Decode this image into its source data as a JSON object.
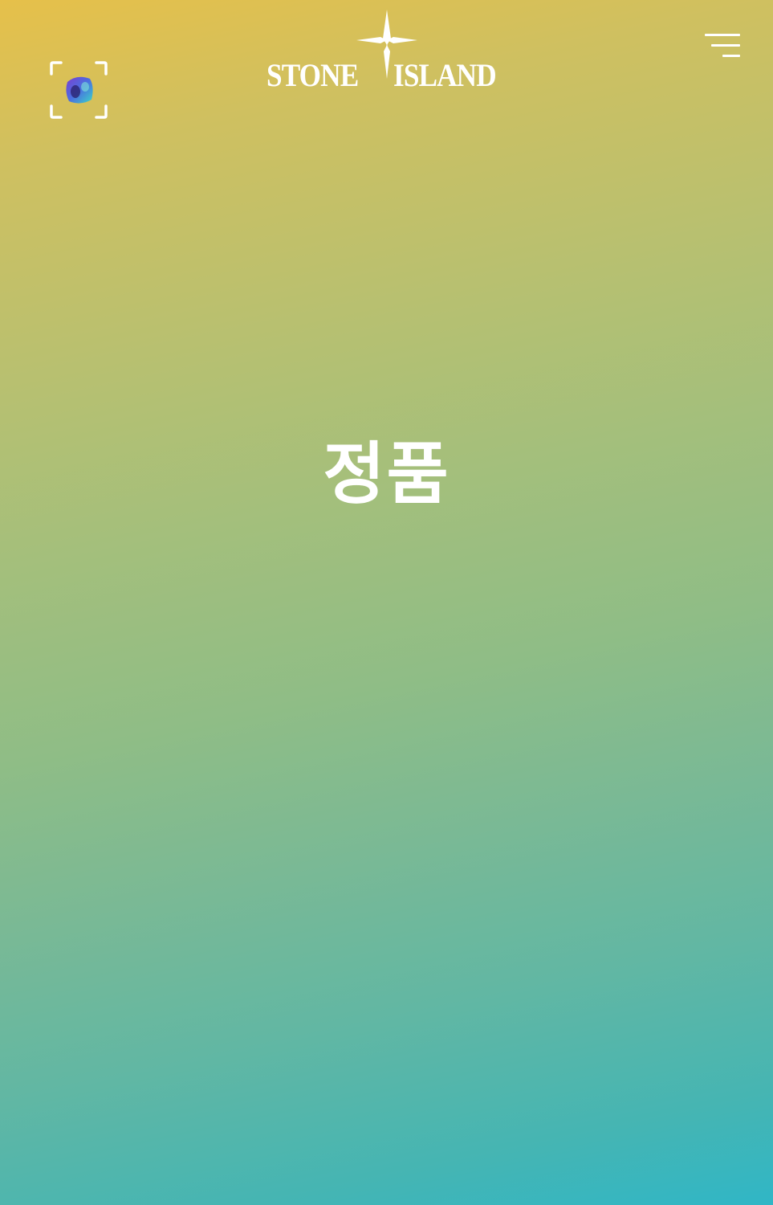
{
  "header": {
    "brand_left": "STONE",
    "brand_right": "ISLAND",
    "scan_icon": "ar-scan-icon",
    "logo_icon": "compass-star-icon",
    "menu_icon": "hamburger-menu-icon"
  },
  "main": {
    "headline": "정품"
  },
  "colors": {
    "gradient_top": "#e6c04a",
    "gradient_bottom": "#30b6c6",
    "foreground": "#ffffff"
  }
}
